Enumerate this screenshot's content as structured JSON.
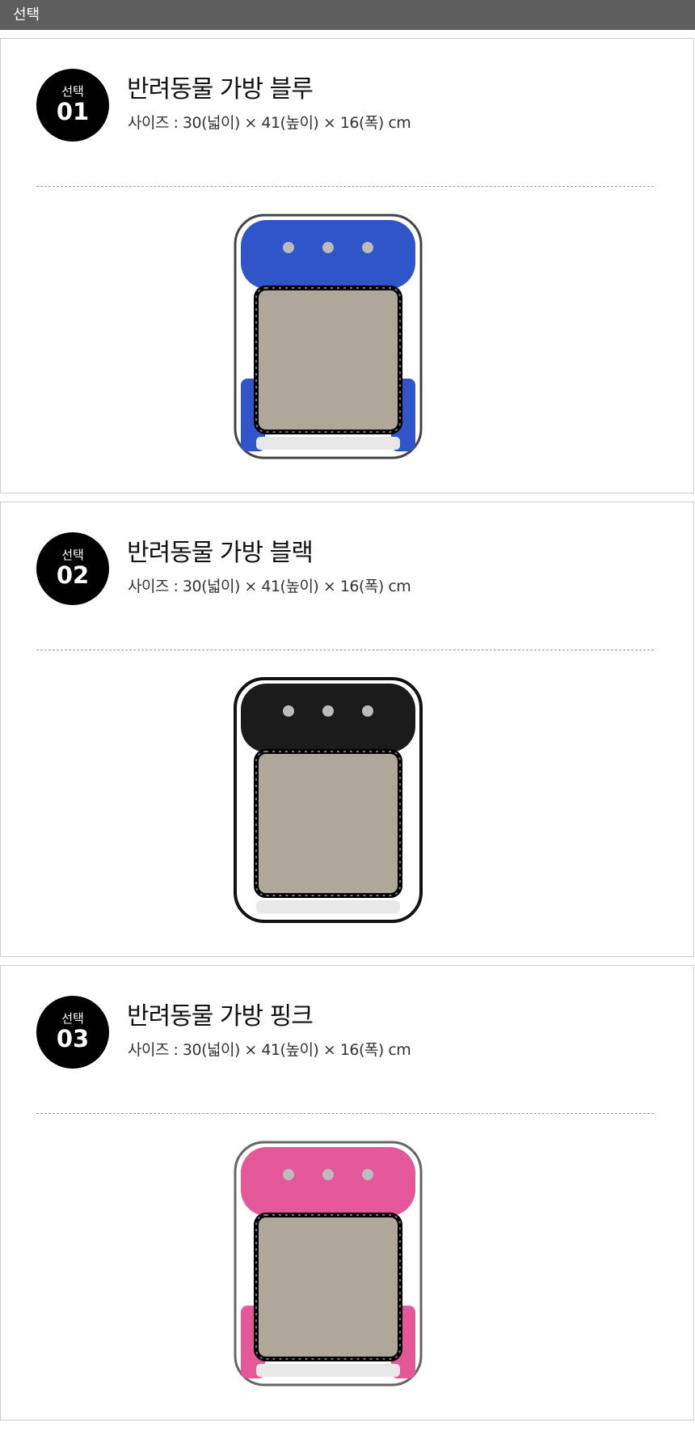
{
  "header": {
    "title": "선택"
  },
  "options": [
    {
      "badge_label": "선택",
      "badge_num": "01",
      "title": "반려동물 가방 블루",
      "size": "사이즈 :  30(넓이) × 41(높이) × 16(폭) cm",
      "color": "#2f55c9"
    },
    {
      "badge_label": "선택",
      "badge_num": "02",
      "title": "반려동물 가방 블랙",
      "size": "사이즈 :  30(넓이) × 41(높이) × 16(폭) cm",
      "color": "#1b1b1b"
    },
    {
      "badge_label": "선택",
      "badge_num": "03",
      "title": "반려동물 가방 핑크",
      "size": "사이즈 :  30(넓이) × 41(높이) × 16(폭) cm",
      "color": "#e4589a"
    }
  ],
  "icons": {
    "product_image": "pet-backpack-icon"
  }
}
